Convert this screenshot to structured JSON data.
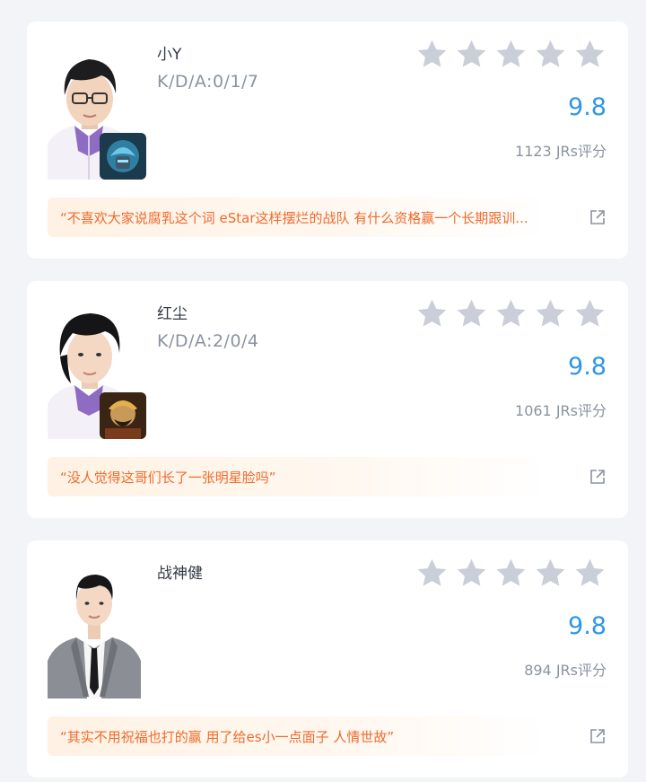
{
  "colors": {
    "background": "#f2f4f7",
    "card": "#ffffff",
    "score": "#2e97e6",
    "star": "#c9ced8",
    "quote_text": "#f06a2c",
    "quote_bg": "#fff2e4"
  },
  "players": [
    {
      "name": "小Y",
      "kda": "K/D/A:0/1/7",
      "stars_filled": 0,
      "stars_total": 5,
      "score": "9.8",
      "rating_count": "1123 JRs评分",
      "quote": "“不喜欢大家说腐乳这个词 eStar这样摆烂的战队 有什么资格赢一个长期跟训...",
      "avatar_icon": "player-avatar-icon",
      "hero_icon": "hero-badge-icon",
      "share_icon": "share-icon"
    },
    {
      "name": "红尘",
      "kda": "K/D/A:2/0/4",
      "stars_filled": 0,
      "stars_total": 5,
      "score": "9.8",
      "rating_count": "1061 JRs评分",
      "quote": "“没人觉得这哥们长了一张明星脸吗”",
      "avatar_icon": "player-avatar-icon",
      "hero_icon": "hero-badge-icon",
      "share_icon": "share-icon"
    },
    {
      "name": "战神健",
      "kda": "",
      "stars_filled": 0,
      "stars_total": 5,
      "score": "9.8",
      "rating_count": "894 JRs评分",
      "quote": "“其实不用祝福也打的赢 用了给es小一点面子 人情世故”",
      "avatar_icon": "coach-avatar-icon",
      "share_icon": "share-icon"
    }
  ]
}
